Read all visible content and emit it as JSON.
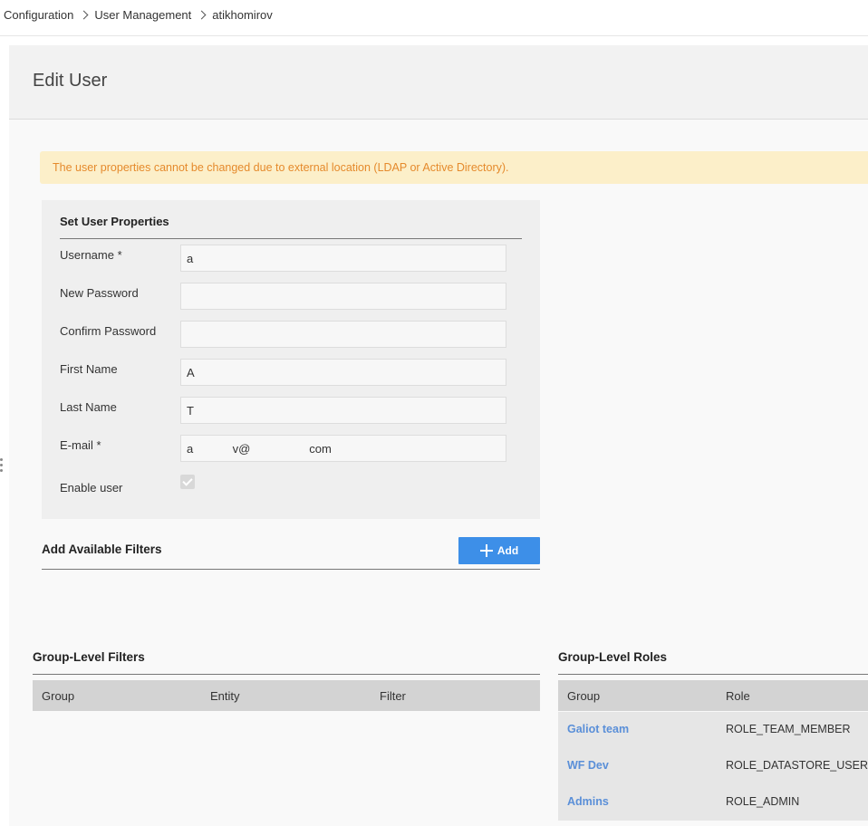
{
  "breadcrumb": {
    "items": [
      "Configuration",
      "User Management",
      "atikhomirov"
    ]
  },
  "page": {
    "title": "Edit User",
    "warning": "The user properties cannot be changed due to external location (LDAP or Active Directory)."
  },
  "properties": {
    "title": "Set User Properties",
    "fields": [
      {
        "label": "Username *",
        "value": "a"
      },
      {
        "label": "New Password",
        "value": ""
      },
      {
        "label": "Confirm Password",
        "value": ""
      },
      {
        "label": "First Name",
        "value": "A"
      },
      {
        "label": "Last Name",
        "value": "T"
      },
      {
        "label": "E-mail *",
        "value": "a            v@                  com"
      }
    ],
    "enable_label": "Enable user",
    "enable_checked": true
  },
  "filters": {
    "title": "Add Available Filters",
    "add_label": "Add"
  },
  "group_filters": {
    "title": "Group-Level Filters",
    "columns": [
      "Group",
      "Entity",
      "Filter"
    ]
  },
  "group_roles": {
    "title": "Group-Level Roles",
    "columns": [
      "Group",
      "Role"
    ],
    "rows": [
      {
        "group": "Galiot team",
        "role": "ROLE_TEAM_MEMBER"
      },
      {
        "group": "WF Dev",
        "role": "ROLE_DATASTORE_USER"
      },
      {
        "group": "Admins",
        "role": "ROLE_ADMIN"
      }
    ]
  },
  "colors": {
    "accent": "#3d8fe8",
    "link": "#5a8fd8",
    "warning_bg": "#fcefc9",
    "warning_text": "#e58a2c"
  }
}
